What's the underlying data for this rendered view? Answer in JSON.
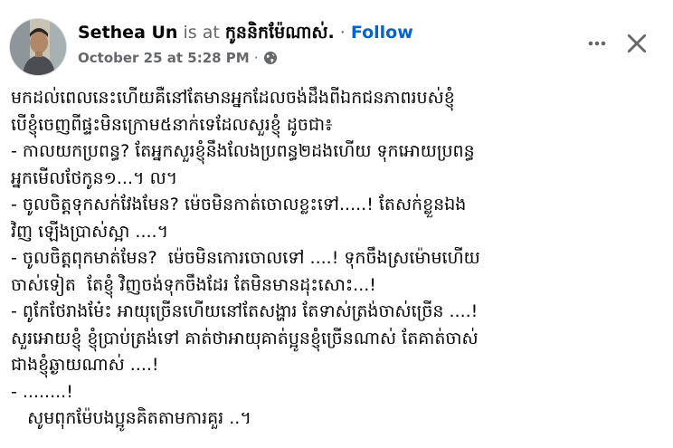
{
  "post": {
    "author": "Sethea Un",
    "at_text": "is at",
    "place": "កូននិកម៉ែណាស់.",
    "separator": "·",
    "follow_label": "Follow",
    "timestamp": "October 25 at 5:28 PM",
    "timestamp_separator": "·",
    "privacy_icon": "globe-icon",
    "more_icon": "more-options-icon",
    "close_icon": "close-icon",
    "body_lines": [
      "មកដល់ពេលនេះហើយគឺនៅតែមានអ្នកដែលចង់ដឹងពីឯកជនភាពរបស់ខ្ញុំ",
      "បើខ្ញុំចេញពីផ្ទះមិនក្រោម៥នាក់ទេដែលសួរខ្ញុំ ដូចជា៖",
      "- កាលយកប្រពន្ធ? តែអ្នកសួរខ្ញុំនឹងលែងប្រពន្ធ២ដងហើយ ទុកអោយប្រពន្ធ",
      "អ្នកមើលថែកូន១...។ ល។",
      "- ចូលចិត្តទុកសក់វែងមែន? ម៉េចមិនកាត់ចោលខ្លះទៅ.....! តែសក់ខ្លួនឯង",
      "វិញ ឡើងប្រាស់ស្អា ....។",
      "- ចូលចិត្តពុកមាត់មែន?  ម៉េចមិនកោរចោលទៅ ....! ទុកចឹងស្រម៉ោមហើយ",
      "ចាស់ទៀត  តែខ្ញុំ វិញចង់ទុកចឹងដែរ តែមិនមានដុះសោះ...!",
      "- ពូកែថែរាងមែ៎ះ អាយុច្រើនហើយនៅតែសង្ហារ តែទាស់ត្រង់ចាស់ច្រើន ....!",
      "សួរអោយខ្ញុំ ខ្ញុំប្រាប់ត្រង់ទៅ គាត់ថាអាយុគាត់ប្អូនខ្ញុំច្រើនណាស់ តែគាត់ចាស់",
      "ជាងខ្ញុំឆ្ងាយណាស់ ....!",
      "- ........!",
      "   សូមពុកម៉ែបងប្អូនគិតតាមការគួរ ..។"
    ]
  },
  "colors": {
    "text": "#050505",
    "secondary": "#65676b",
    "link": "#0064d1",
    "background": "#ffffff"
  }
}
